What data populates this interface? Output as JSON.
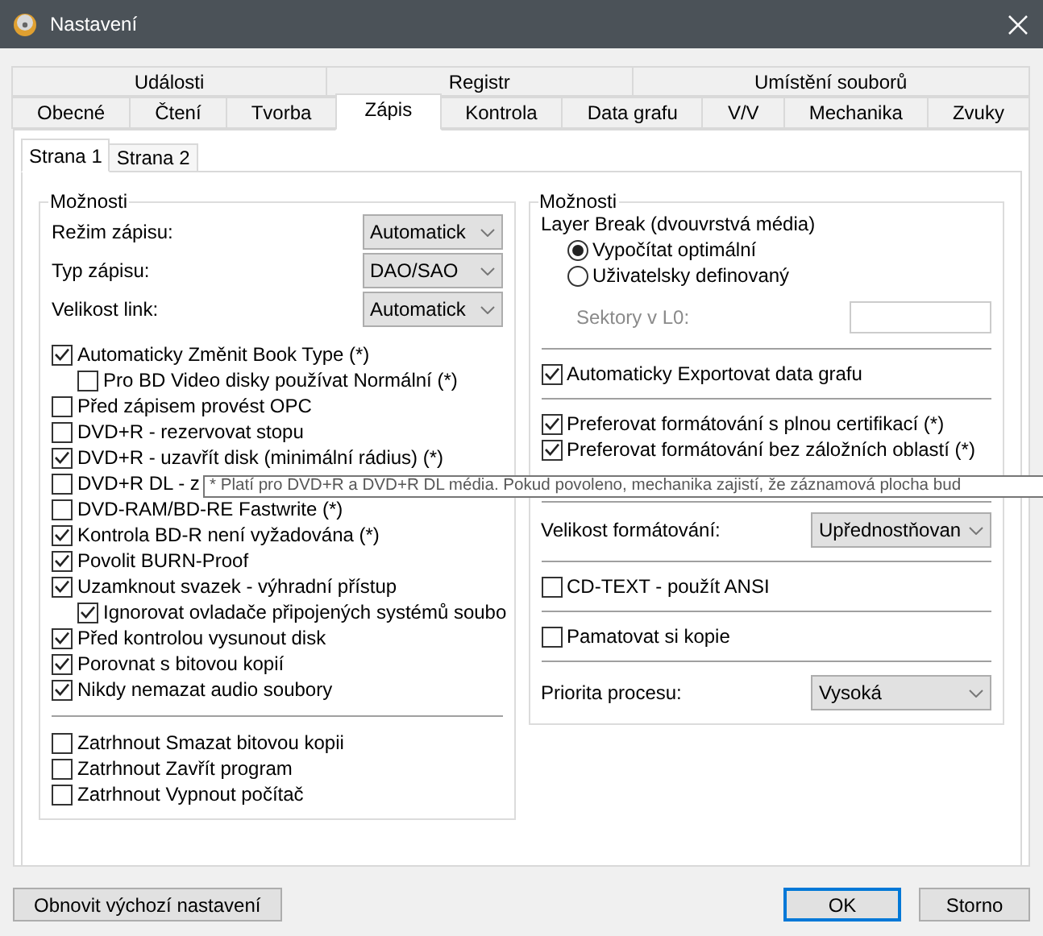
{
  "window": {
    "title": "Nastavení"
  },
  "tab_rows": [
    {
      "tabs": [
        {
          "label": "Události",
          "selected": false
        },
        {
          "label": "Registr",
          "selected": false
        },
        {
          "label": "Umístění souborů",
          "selected": false
        }
      ]
    },
    {
      "tabs": [
        {
          "label": "Obecné",
          "selected": false
        },
        {
          "label": "Čtení",
          "selected": false
        },
        {
          "label": "Tvorba",
          "selected": false
        },
        {
          "label": "Zápis",
          "selected": true
        },
        {
          "label": "Kontrola",
          "selected": false
        },
        {
          "label": "Data grafu",
          "selected": false
        },
        {
          "label": "V/V",
          "selected": false
        },
        {
          "label": "Mechanika",
          "selected": false
        },
        {
          "label": "Zvuky",
          "selected": false
        }
      ]
    }
  ],
  "page_tabs": [
    {
      "label": "Strana 1",
      "selected": true
    },
    {
      "label": "Strana 2",
      "selected": false
    }
  ],
  "left_group": {
    "title": "Možnosti",
    "fields": [
      {
        "label": "Režim zápisu:",
        "value": "Automatick"
      },
      {
        "label": "Typ zápisu:",
        "value": "DAO/SAO"
      },
      {
        "label": "Velikost link:",
        "value": "Automatick"
      }
    ],
    "checks": [
      {
        "label": "Automaticky Změnit Book Type (*)",
        "checked": true,
        "children": [
          {
            "label": "Pro BD Video disky používat Normální (*)",
            "checked": false
          }
        ]
      },
      {
        "label": "Před zápisem provést OPC",
        "checked": false
      },
      {
        "label": "DVD+R - rezervovat stopu",
        "checked": false
      },
      {
        "label": "DVD+R - uzavřít disk (minimální rádius) (*)",
        "checked": true
      },
      {
        "label": "DVD+R DL - z",
        "checked": false
      },
      {
        "label": "DVD-RAM/BD-RE Fastwrite (*)",
        "checked": false
      },
      {
        "label": "Kontrola BD-R není vyžadována (*)",
        "checked": true
      },
      {
        "label": "Povolit BURN-Proof",
        "checked": true
      },
      {
        "label": "Uzamknout svazek - výhradní přístup",
        "checked": true,
        "children": [
          {
            "label": "Ignorovat ovladače připojených systémů soubo",
            "checked": true
          }
        ]
      },
      {
        "label": "Před kontrolou vysunout disk",
        "checked": true
      },
      {
        "label": "Porovnat s bitovou kopií",
        "checked": true
      },
      {
        "label": "Nikdy nemazat audio soubory",
        "checked": true
      }
    ],
    "extra_checks": [
      {
        "label": "Zatrhnout Smazat bitovou kopii",
        "checked": false
      },
      {
        "label": "Zatrhnout Zavřít program",
        "checked": false
      },
      {
        "label": "Zatrhnout Vypnout počítač",
        "checked": false
      }
    ]
  },
  "right_group": {
    "title": "Možnosti",
    "layer_break": {
      "label": "Layer Break (dvouvrstvá média)",
      "options": [
        {
          "label": "Vypočítat optimální",
          "selected": true
        },
        {
          "label": "Uživatelsky definovaný",
          "selected": false
        }
      ],
      "sectors": {
        "label": "Sektory v L0:",
        "disabled": true
      }
    },
    "sections": [
      {
        "kind": "checks",
        "items": [
          {
            "label": "Automaticky Exportovat data grafu",
            "checked": true
          }
        ]
      },
      {
        "kind": "checks",
        "items": [
          {
            "label": "Preferovat formátování s plnou certifikací (*)",
            "checked": true
          },
          {
            "label": "Preferovat formátování bez záložních oblastí (*)",
            "checked": true
          }
        ]
      },
      {
        "kind": "select",
        "label": "Velikost formátování:",
        "value": "Upřednostňovan"
      },
      {
        "kind": "checks",
        "items": [
          {
            "label": "CD-TEXT - použít ANSI",
            "checked": false
          }
        ]
      },
      {
        "kind": "checks",
        "items": [
          {
            "label": "Pamatovat si kopie",
            "checked": false
          }
        ]
      },
      {
        "kind": "select",
        "label": "Priorita procesu:",
        "value": "Vysoká"
      }
    ]
  },
  "tooltip": {
    "text": "* Platí pro DVD+R a DVD+R DL média. Pokud povoleno, mechanika zajistí, že záznamová plocha bud"
  },
  "reset_button": {
    "label": "Obnovit výchozí nastavení"
  },
  "dialog_buttons": [
    {
      "label": "OK",
      "default": true
    },
    {
      "label": "Storno",
      "default": false
    }
  ]
}
